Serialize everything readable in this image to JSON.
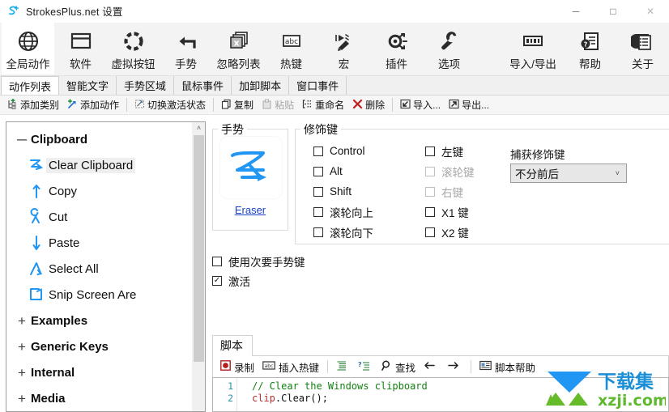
{
  "window": {
    "title": "StrokesPlus.net 设置",
    "app_icon": "strokesplus-logo-icon",
    "minimize": "─",
    "maximize": "□",
    "close": "✕"
  },
  "ribbon": {
    "items": [
      {
        "label": "全局动作",
        "icon": "globe-icon",
        "active": true
      },
      {
        "label": "软件",
        "icon": "window-icon",
        "active": false
      },
      {
        "label": "虚拟按钮",
        "icon": "dotted-circle-icon",
        "active": false
      },
      {
        "label": "手势",
        "icon": "gesture-arrow-icon",
        "active": false
      },
      {
        "label": "忽略列表",
        "icon": "ignore-list-icon",
        "active": false
      },
      {
        "label": "热键",
        "icon": "abc-key-icon",
        "active": false
      },
      {
        "label": "宏",
        "icon": "macro-record-icon",
        "active": false
      },
      {
        "label": "插件",
        "icon": "plugin-icon",
        "active": false
      },
      {
        "label": "选项",
        "icon": "wrench-icon",
        "active": false
      }
    ],
    "right_items": [
      {
        "label": "导入/导出",
        "icon": "import-export-icon"
      },
      {
        "label": "帮助",
        "icon": "help-document-icon"
      },
      {
        "label": "关于",
        "icon": "about-info-icon"
      }
    ]
  },
  "tabs": [
    {
      "label": "动作列表",
      "selected": true
    },
    {
      "label": "智能文字",
      "selected": false
    },
    {
      "label": "手势区域",
      "selected": false
    },
    {
      "label": "鼠标事件",
      "selected": false
    },
    {
      "label": "加卸脚本",
      "selected": false
    },
    {
      "label": "窗口事件",
      "selected": false
    }
  ],
  "action_toolbar": {
    "items": [
      {
        "label": "添加类别",
        "icon": "add-category-icon",
        "disabled": false
      },
      {
        "label": "添加动作",
        "icon": "add-action-icon",
        "disabled": false
      },
      {
        "sep": true
      },
      {
        "label": "切换激活状态",
        "icon": "toggle-enabled-icon",
        "disabled": false
      },
      {
        "sep": true
      },
      {
        "label": "复制",
        "icon": "copy-icon",
        "disabled": false
      },
      {
        "label": "粘贴",
        "icon": "paste-icon",
        "disabled": true
      },
      {
        "label": "重命名",
        "icon": "rename-icon",
        "disabled": false
      },
      {
        "label": "删除",
        "icon": "delete-x-icon",
        "disabled": false
      },
      {
        "sep": true
      },
      {
        "label": "导入...",
        "icon": "import-arrow-icon",
        "disabled": false
      },
      {
        "label": "导出...",
        "icon": "export-arrow-icon",
        "disabled": false
      }
    ]
  },
  "tree": {
    "scrollbar": {
      "arrow_up": "˄"
    },
    "nodes": [
      {
        "label": "Clipboard",
        "type": "group",
        "expander": "─",
        "glyph": ""
      },
      {
        "label": "Clear Clipboard",
        "type": "child",
        "glyph": "gesture-z-icon",
        "selected": true
      },
      {
        "label": "Copy",
        "type": "child",
        "glyph": "gesture-up-arrow-icon",
        "selected": false
      },
      {
        "label": "Cut",
        "type": "child",
        "glyph": "gesture-loop-icon",
        "selected": false
      },
      {
        "label": "Paste",
        "type": "child",
        "glyph": "gesture-down-arrow-icon",
        "selected": false
      },
      {
        "label": "Select All",
        "type": "child",
        "glyph": "gesture-caret-icon",
        "selected": false
      },
      {
        "label": "Snip Screen Are",
        "type": "child",
        "glyph": "gesture-square-icon",
        "selected": false
      },
      {
        "label": "Examples",
        "type": "group",
        "expander": "+",
        "glyph": ""
      },
      {
        "label": "Generic Keys",
        "type": "group",
        "expander": "+",
        "glyph": ""
      },
      {
        "label": "Internal",
        "type": "group",
        "expander": "+",
        "glyph": ""
      },
      {
        "label": "Media",
        "type": "group",
        "expander": "+",
        "glyph": ""
      }
    ]
  },
  "gesture_box": {
    "title": "手势",
    "gesture_icon": "gesture-z-stroke-icon",
    "gesture_name": "Eraser"
  },
  "modifier_box": {
    "title": "修饰键",
    "column1": [
      {
        "label": "Control",
        "checked": false,
        "disabled": false
      },
      {
        "label": "Alt",
        "checked": false,
        "disabled": false
      },
      {
        "label": "Shift",
        "checked": false,
        "disabled": false
      },
      {
        "label": "滚轮向上",
        "checked": false,
        "disabled": false
      },
      {
        "label": "滚轮向下",
        "checked": false,
        "disabled": false
      }
    ],
    "column2": [
      {
        "label": "左键",
        "checked": false,
        "disabled": false
      },
      {
        "label": "滚轮键",
        "checked": false,
        "disabled": true
      },
      {
        "label": "右键",
        "checked": false,
        "disabled": true
      },
      {
        "label": "X1 键",
        "checked": false,
        "disabled": false
      },
      {
        "label": "X2 键",
        "checked": false,
        "disabled": false
      }
    ],
    "capture_label": "捕获修饰键",
    "capture_value": "不分前后",
    "capture_caret": "˅"
  },
  "options": [
    {
      "label": "使用次要手势键",
      "checked": false
    },
    {
      "label": "激活",
      "checked": true
    }
  ],
  "script_panel": {
    "tab_label": "脚本",
    "toolbar": [
      {
        "label": "录制",
        "icon": "record-icon"
      },
      {
        "label": "插入热键",
        "icon": "abc-key-icon"
      },
      {
        "sep": true
      },
      {
        "label": "",
        "icon": "format-lines-icon"
      },
      {
        "label": "",
        "icon": "intellisense-icon"
      },
      {
        "label": "查找",
        "icon": "search-icon"
      },
      {
        "label": "",
        "icon": "arrow-left-icon"
      },
      {
        "label": "",
        "icon": "arrow-right-icon"
      },
      {
        "sep": true
      },
      {
        "label": "脚本帮助",
        "icon": "script-help-icon"
      }
    ],
    "line_numbers": [
      "1",
      "2"
    ],
    "code_lines": [
      {
        "segments": [
          {
            "text": "// Clear the Windows clipboard",
            "style": "comment"
          }
        ]
      },
      {
        "segments": [
          {
            "text": "clip",
            "style": "ident"
          },
          {
            "text": ".Clear();",
            "style": "plain"
          }
        ]
      }
    ]
  },
  "watermark": {
    "title_cn": "下载集",
    "url": "xzji.com"
  },
  "colors": {
    "accent_blue": "#2196f3",
    "ribbon_bg": "#f3f3f3",
    "link": "#1a3fc4",
    "comment_green": "#108010",
    "ident_red": "#b03030",
    "line_number": "#2b91af"
  }
}
